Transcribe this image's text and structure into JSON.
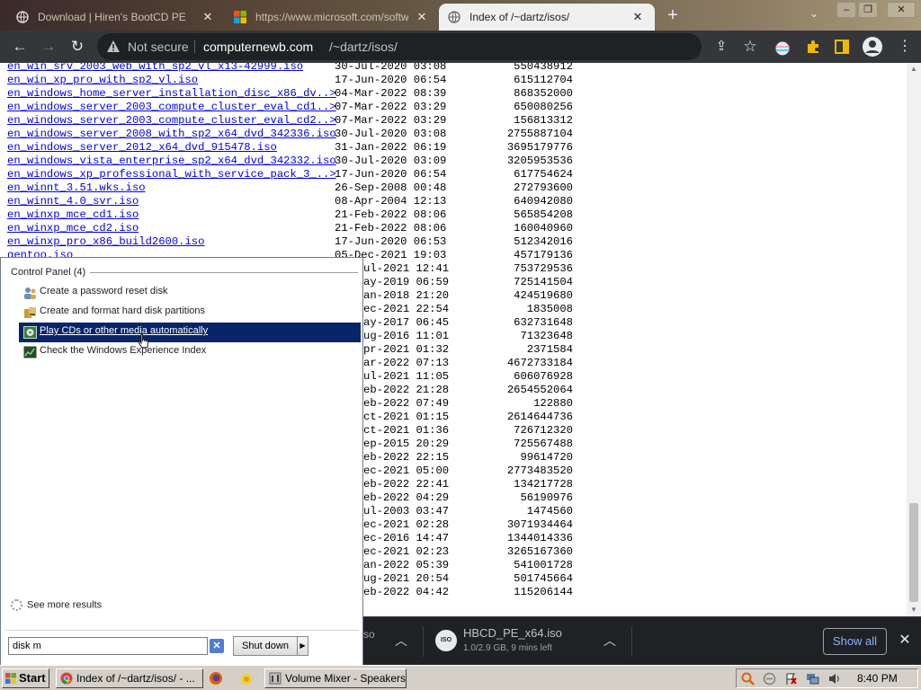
{
  "browser": {
    "tabs": [
      {
        "title": "Download | Hiren's BootCD PE",
        "active": false
      },
      {
        "title": "https://www.microsoft.com/software",
        "active": false
      },
      {
        "title": "Index of /~dartz/isos/",
        "active": true
      }
    ],
    "address": {
      "security_label": "Not secure",
      "domain": "computernewb.com",
      "path": "/~dartz/isos/"
    },
    "profile_avatar": "person-icon"
  },
  "listing": {
    "rows": [
      {
        "name": "en_win_srv_2003_web_with_sp2_vl_x13-42999.iso",
        "date": "30-Jul-2020 03:08",
        "size": "550438912"
      },
      {
        "name": "en_win_xp_pro_with_sp2_vl.iso",
        "date": "17-Jun-2020 06:54",
        "size": "615112704"
      },
      {
        "name": "en_windows_home_server_installation_disc_x86_dv..>",
        "date": "04-Mar-2022 08:39",
        "size": "868352000"
      },
      {
        "name": "en_windows_server_2003_compute_cluster_eval_cd1..>",
        "date": "07-Mar-2022 03:29",
        "size": "650080256"
      },
      {
        "name": "en_windows_server_2003_compute_cluster_eval_cd2..>",
        "date": "07-Mar-2022 03:29",
        "size": "156813312"
      },
      {
        "name": "en_windows_server_2008_with_sp2_x64_dvd_342336.iso",
        "date": "30-Jul-2020 03:08",
        "size": "2755887104"
      },
      {
        "name": "en_windows_server_2012_x64_dvd_915478.iso",
        "date": "31-Jan-2022 06:19",
        "size": "3695179776"
      },
      {
        "name": "en_windows_vista_enterprise_sp2_x64_dvd_342332.iso",
        "date": "30-Jul-2020 03:09",
        "size": "3205953536"
      },
      {
        "name": "en_windows_xp_professional_with_service_pack_3_..>",
        "date": "17-Jun-2020 06:54",
        "size": "617754624"
      },
      {
        "name": "en_winnt_3.51.wks.iso",
        "date": "26-Sep-2008 00:48",
        "size": "272793600"
      },
      {
        "name": "en_winnt_4.0_svr.iso",
        "date": "08-Apr-2004 12:13",
        "size": "640942080"
      },
      {
        "name": "en_winxp_mce_cd1.iso",
        "date": "21-Feb-2022 08:06",
        "size": "565854208"
      },
      {
        "name": "en_winxp_mce_cd2.iso",
        "date": "21-Feb-2022 08:06",
        "size": "160040960"
      },
      {
        "name": "en_winxp_pro_x86_build2600.iso",
        "date": "17-Jun-2020 06:53",
        "size": "512342016"
      },
      {
        "name": "gentoo.iso",
        "date": "05-Dec-2021 19:03",
        "size": "457179136"
      }
    ],
    "occluded_rows": [
      {
        "frag": "ul-2021 12:41",
        "size": "753729536"
      },
      {
        "frag": "ay-2019 06:59",
        "size": "725141504"
      },
      {
        "frag": "an-2018 21:20",
        "size": "424519680"
      },
      {
        "frag": "ec-2021 22:54",
        "size": "1835008"
      },
      {
        "frag": "ay-2017 06:45",
        "size": "632731648"
      },
      {
        "frag": "ug-2016 11:01",
        "size": "71323648"
      },
      {
        "frag": "pr-2021 01:32",
        "size": "2371584"
      },
      {
        "frag": "ar-2022 07:13",
        "size": "4672733184"
      },
      {
        "frag": "ul-2021 11:05",
        "size": "606076928"
      },
      {
        "frag": "eb-2022 21:28",
        "size": "2654552064"
      },
      {
        "frag": "eb-2022 07:49",
        "size": "122880"
      },
      {
        "frag": "ct-2021 01:15",
        "size": "2614644736"
      },
      {
        "frag": "ct-2021 01:36",
        "size": "726712320"
      },
      {
        "frag": "ep-2015 20:29",
        "size": "725567488"
      },
      {
        "frag": "eb-2022 22:15",
        "size": "99614720"
      },
      {
        "frag": "ec-2021 05:00",
        "size": "2773483520"
      },
      {
        "frag": "eb-2022 22:41",
        "size": "134217728"
      },
      {
        "frag": "eb-2022 04:29",
        "size": "56190976"
      },
      {
        "frag": "ul-2003 03:47",
        "size": "1474560"
      },
      {
        "frag": "ec-2021 02:28",
        "size": "3071934464"
      },
      {
        "frag": "ec-2016 14:47",
        "size": "1344014336"
      },
      {
        "frag": "ec-2021 02:23",
        "size": "3265167360"
      },
      {
        "frag": "an-2022 05:39",
        "size": "541001728"
      },
      {
        "frag": "ug-2021 20:54",
        "size": "501745664"
      },
      {
        "frag": "eb-2022 04:42",
        "size": "115206144"
      }
    ]
  },
  "downloads": {
    "partial_label": "so",
    "file_name": "HBCD_PE_x64.iso",
    "file_icon_text": "ISO",
    "status": "1.0/2.9 GB, 9 mins left",
    "show_all": "Show all"
  },
  "startmenu": {
    "group_header": "Control Panel (4)",
    "items": [
      {
        "label": "Create a password reset disk",
        "icon": "users-icon",
        "selected": false
      },
      {
        "label": "Create and format hard disk partitions",
        "icon": "disk-management-icon",
        "selected": false
      },
      {
        "label": "Play CDs or other media automatically",
        "icon": "autoplay-icon",
        "selected": true
      },
      {
        "label": "Check the Windows Experience Index",
        "icon": "performance-icon",
        "selected": false
      }
    ],
    "see_more": "See more results",
    "search_value": "disk m",
    "shutdown_label": "Shut down"
  },
  "taskbar": {
    "start_label": "Start",
    "buttons": [
      {
        "label": "Index of /~dartz/isos/ - ...",
        "icon": "chrome-icon"
      },
      {
        "label": "Volume Mixer - Speakers ...",
        "icon": "volume-mixer-icon"
      }
    ],
    "clock": "8:40 PM"
  },
  "colors": {
    "link": "#0000ee",
    "selection": "#0a246a",
    "chrome_dark": "#35363a",
    "download_bar": "#202124",
    "show_all_text": "#8ab4f8"
  }
}
